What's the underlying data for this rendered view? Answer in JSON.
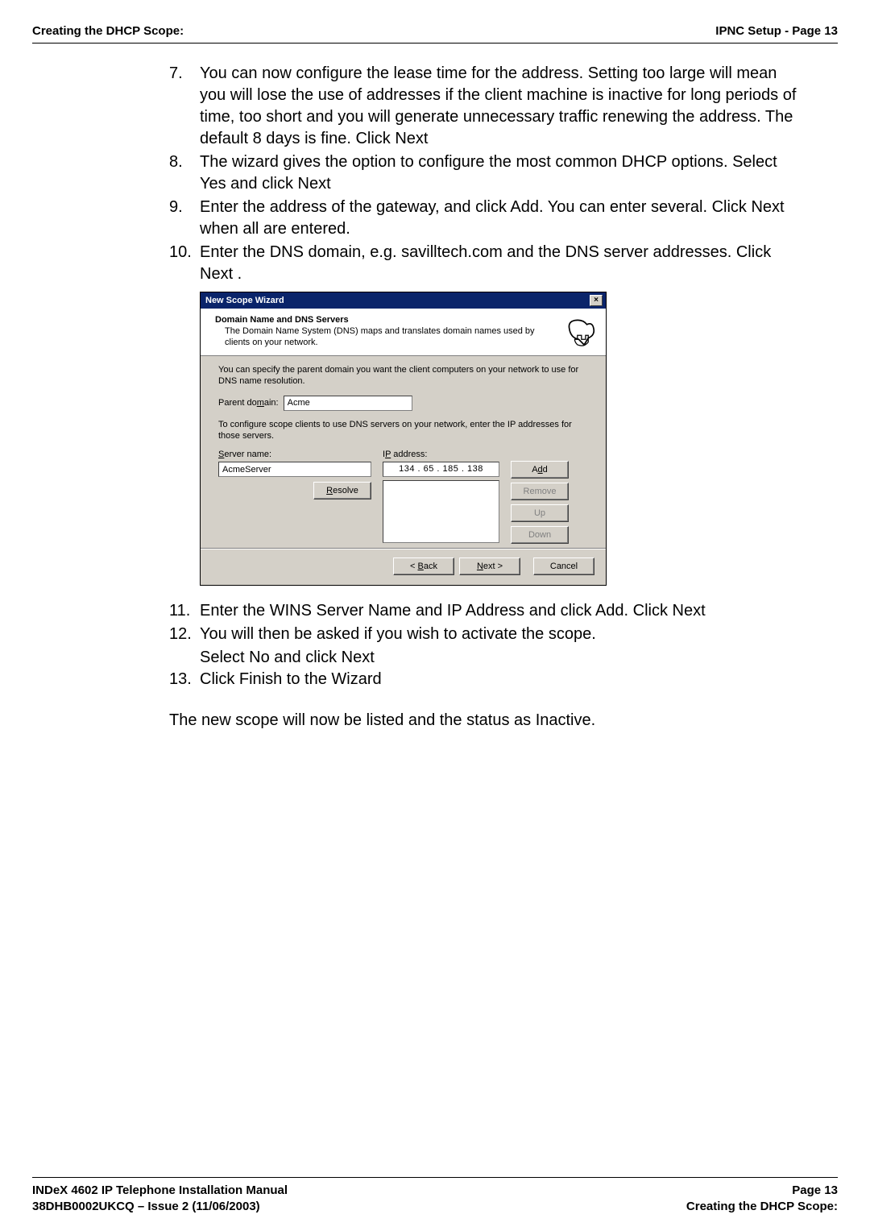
{
  "header": {
    "left": "Creating the DHCP Scope:",
    "right": "IPNC Setup - Page 13"
  },
  "steps": {
    "s7": {
      "num": "7.",
      "text": "You can now configure the lease time for the address. Setting too large will mean you will lose the use of addresses if the client machine is inactive for long periods of time, too short and you will generate unnecessary traffic renewing the address. The default 8 days is fine. Click Next"
    },
    "s8": {
      "num": "8.",
      "text": "The wizard gives the option to configure the most common DHCP options. Select Yes and click Next"
    },
    "s9": {
      "num": "9.",
      "text": "Enter the address of the gateway, and click Add. You can enter several. Click Next when all are entered."
    },
    "s10": {
      "num": "10.",
      "text": "Enter the DNS domain, e.g. savilltech.com and the DNS server addresses. Click Next ."
    },
    "s11": {
      "num": "11.",
      "text": "Enter the WINS Server Name and IP Address and click Add. Click Next"
    },
    "s12": {
      "num": "12.",
      "text": "You will then be asked if you wish to activate the scope."
    },
    "s12b": "Select No and click Next",
    "s13": {
      "num": "13.",
      "text": "Click Finish to the Wizard"
    }
  },
  "after": "The new scope will now be listed and the status as Inactive.",
  "dialog": {
    "title": "New Scope Wizard",
    "close": "×",
    "heading": "Domain Name and DNS Servers",
    "subheading": "The Domain Name System (DNS) maps and translates domain names used by clients on your network.",
    "para1": "You can specify the parent domain you want the client computers on your network to use for DNS name resolution.",
    "parent_label_pre": "Parent do",
    "parent_label_u": "m",
    "parent_label_post": "ain:",
    "parent_value": "Acme",
    "para2": "To configure scope clients to use DNS servers on your network, enter the IP addresses for those servers.",
    "server_label_u": "S",
    "server_label_post": "erver name:",
    "server_value": "AcmeServer",
    "ip_label_pre": "I",
    "ip_label_u": "P",
    "ip_label_post": " address:",
    "ip_value": "134 .  65 . 185 . 138",
    "btn_resolve_u": "R",
    "btn_resolve_post": "esolve",
    "btn_add_pre": "A",
    "btn_add_u": "d",
    "btn_add_post": "d",
    "btn_remove": "Remove",
    "btn_up": "Up",
    "btn_down": "Down",
    "btn_back_pre": "< ",
    "btn_back_u": "B",
    "btn_back_post": "ack",
    "btn_next_u": "N",
    "btn_next_post": "ext >",
    "btn_cancel": "Cancel"
  },
  "footer": {
    "l1": "INDeX 4602 IP Telephone Installation Manual",
    "l2": "38DHB0002UKCQ – Issue 2 (11/06/2003)",
    "r1": "Page 13",
    "r2": "Creating the DHCP Scope:"
  }
}
